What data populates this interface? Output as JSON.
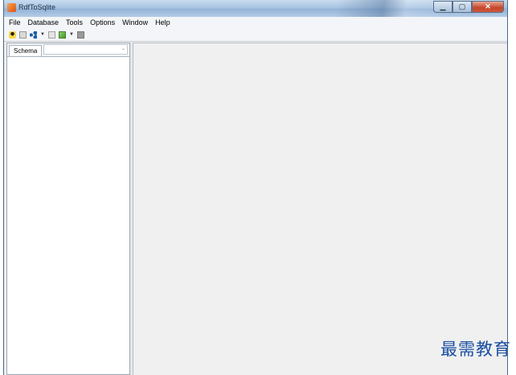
{
  "window": {
    "title": "RdfToSqlite",
    "controls": {
      "minimize": "▁",
      "maximize": "▢",
      "close": "✕"
    }
  },
  "menubar": {
    "items": [
      "File",
      "Database",
      "Tools",
      "Options",
      "Window",
      "Help"
    ]
  },
  "toolbar": {
    "icons": [
      "user-icon",
      "document-icon",
      "share-icon",
      "sql-icon",
      "image-icon",
      "stop-icon"
    ],
    "dropdown_glyph": "▼"
  },
  "left_panel": {
    "tab_label": "Schema",
    "selector_value": "",
    "chevron": "⌄"
  },
  "watermark": "最需教育"
}
